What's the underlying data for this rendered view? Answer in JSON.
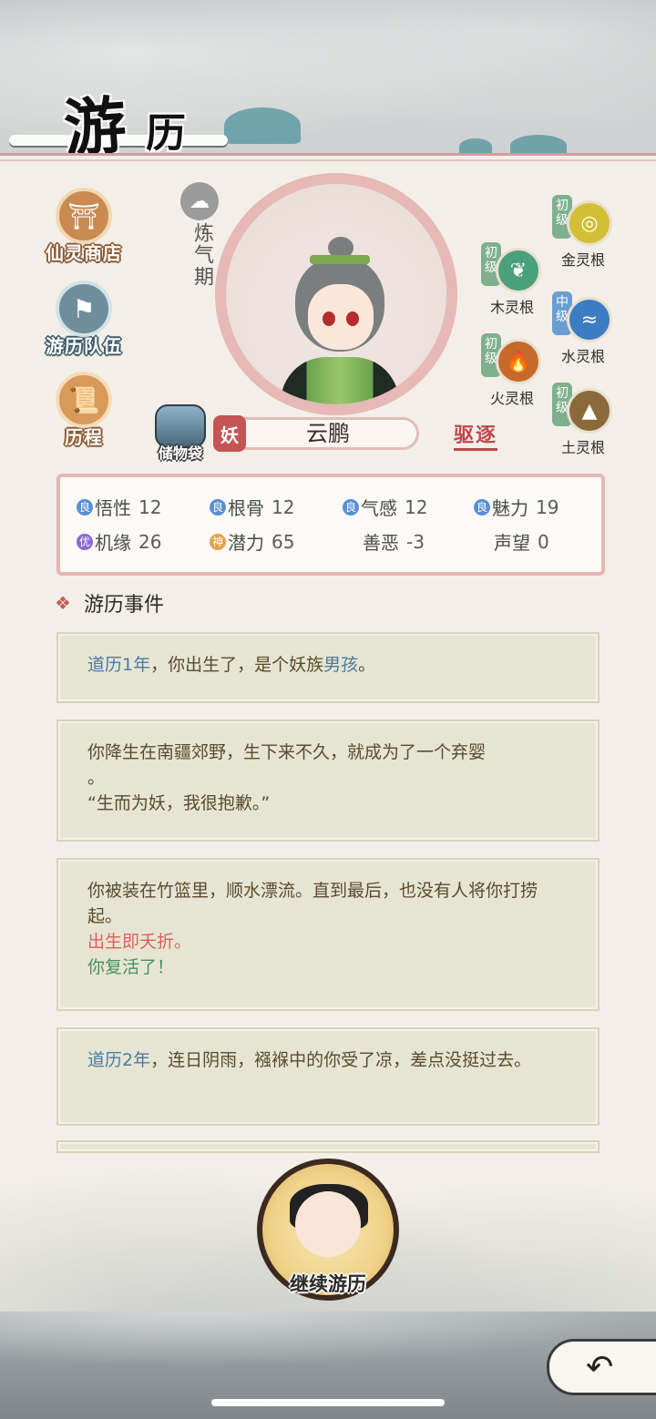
{
  "header": {
    "title_char1": "游",
    "title_char2": "历"
  },
  "sidebar": {
    "shop": "仙灵商店",
    "team": "游历队伍",
    "journey": "历程"
  },
  "character": {
    "realm": "炼气期",
    "race": "妖",
    "name": "云鹏",
    "expel": "驱逐",
    "bag": "储物袋"
  },
  "spirit_roots": [
    {
      "grade": "初级",
      "name": "金灵根",
      "color": "#c9b832"
    },
    {
      "grade": "初级",
      "name": "木灵根",
      "color": "#4aa07a"
    },
    {
      "grade": "中级",
      "name": "水灵根",
      "color": "#3b7dc2"
    },
    {
      "grade": "初级",
      "name": "火灵根",
      "color": "#c66a2b"
    },
    {
      "grade": "初级",
      "name": "土灵根",
      "color": "#8a6a3a"
    }
  ],
  "stats": {
    "row1": [
      {
        "tag": "良",
        "name": "悟性",
        "value": "12"
      },
      {
        "tag": "良",
        "name": "根骨",
        "value": "12"
      },
      {
        "tag": "良",
        "name": "气感",
        "value": "12"
      },
      {
        "tag": "良",
        "name": "魅力",
        "value": "19"
      }
    ],
    "row2": [
      {
        "tag": "优",
        "name": "机缘",
        "value": "26"
      },
      {
        "tag": "神",
        "name": "潜力",
        "value": "65"
      },
      {
        "name": "善恶",
        "value": "-3"
      },
      {
        "name": "声望",
        "value": "0"
      }
    ],
    "tag_colors": {
      "良": "#5b8fd2",
      "优": "#8b6ad0",
      "神": "#e2a24a"
    }
  },
  "events": {
    "title": "游历事件",
    "e1_prefix": "道历1年",
    "e1_text": "，你出生了，是个妖族",
    "e1_highlight": "男孩",
    "e1_end": "。",
    "e2_line1": "你降生在南疆郊野，生下来不久，就成为了一个弃婴",
    "e2_line2": "。",
    "e2_line3": "“生而为妖，我很抱歉。”",
    "e3_line1": "你被装在竹篮里，顺水漂流。直到最后，也没有人将你打捞起。",
    "e3_red": "出生即夭折。",
    "e3_green": "你复活了！",
    "e4_prefix": "道历2年",
    "e4_text": "，连日阴雨，襁褓中的你受了凉，差点没挺过去。"
  },
  "actions": {
    "continue": "继续游历",
    "back_icon": "back-arrow-icon"
  }
}
